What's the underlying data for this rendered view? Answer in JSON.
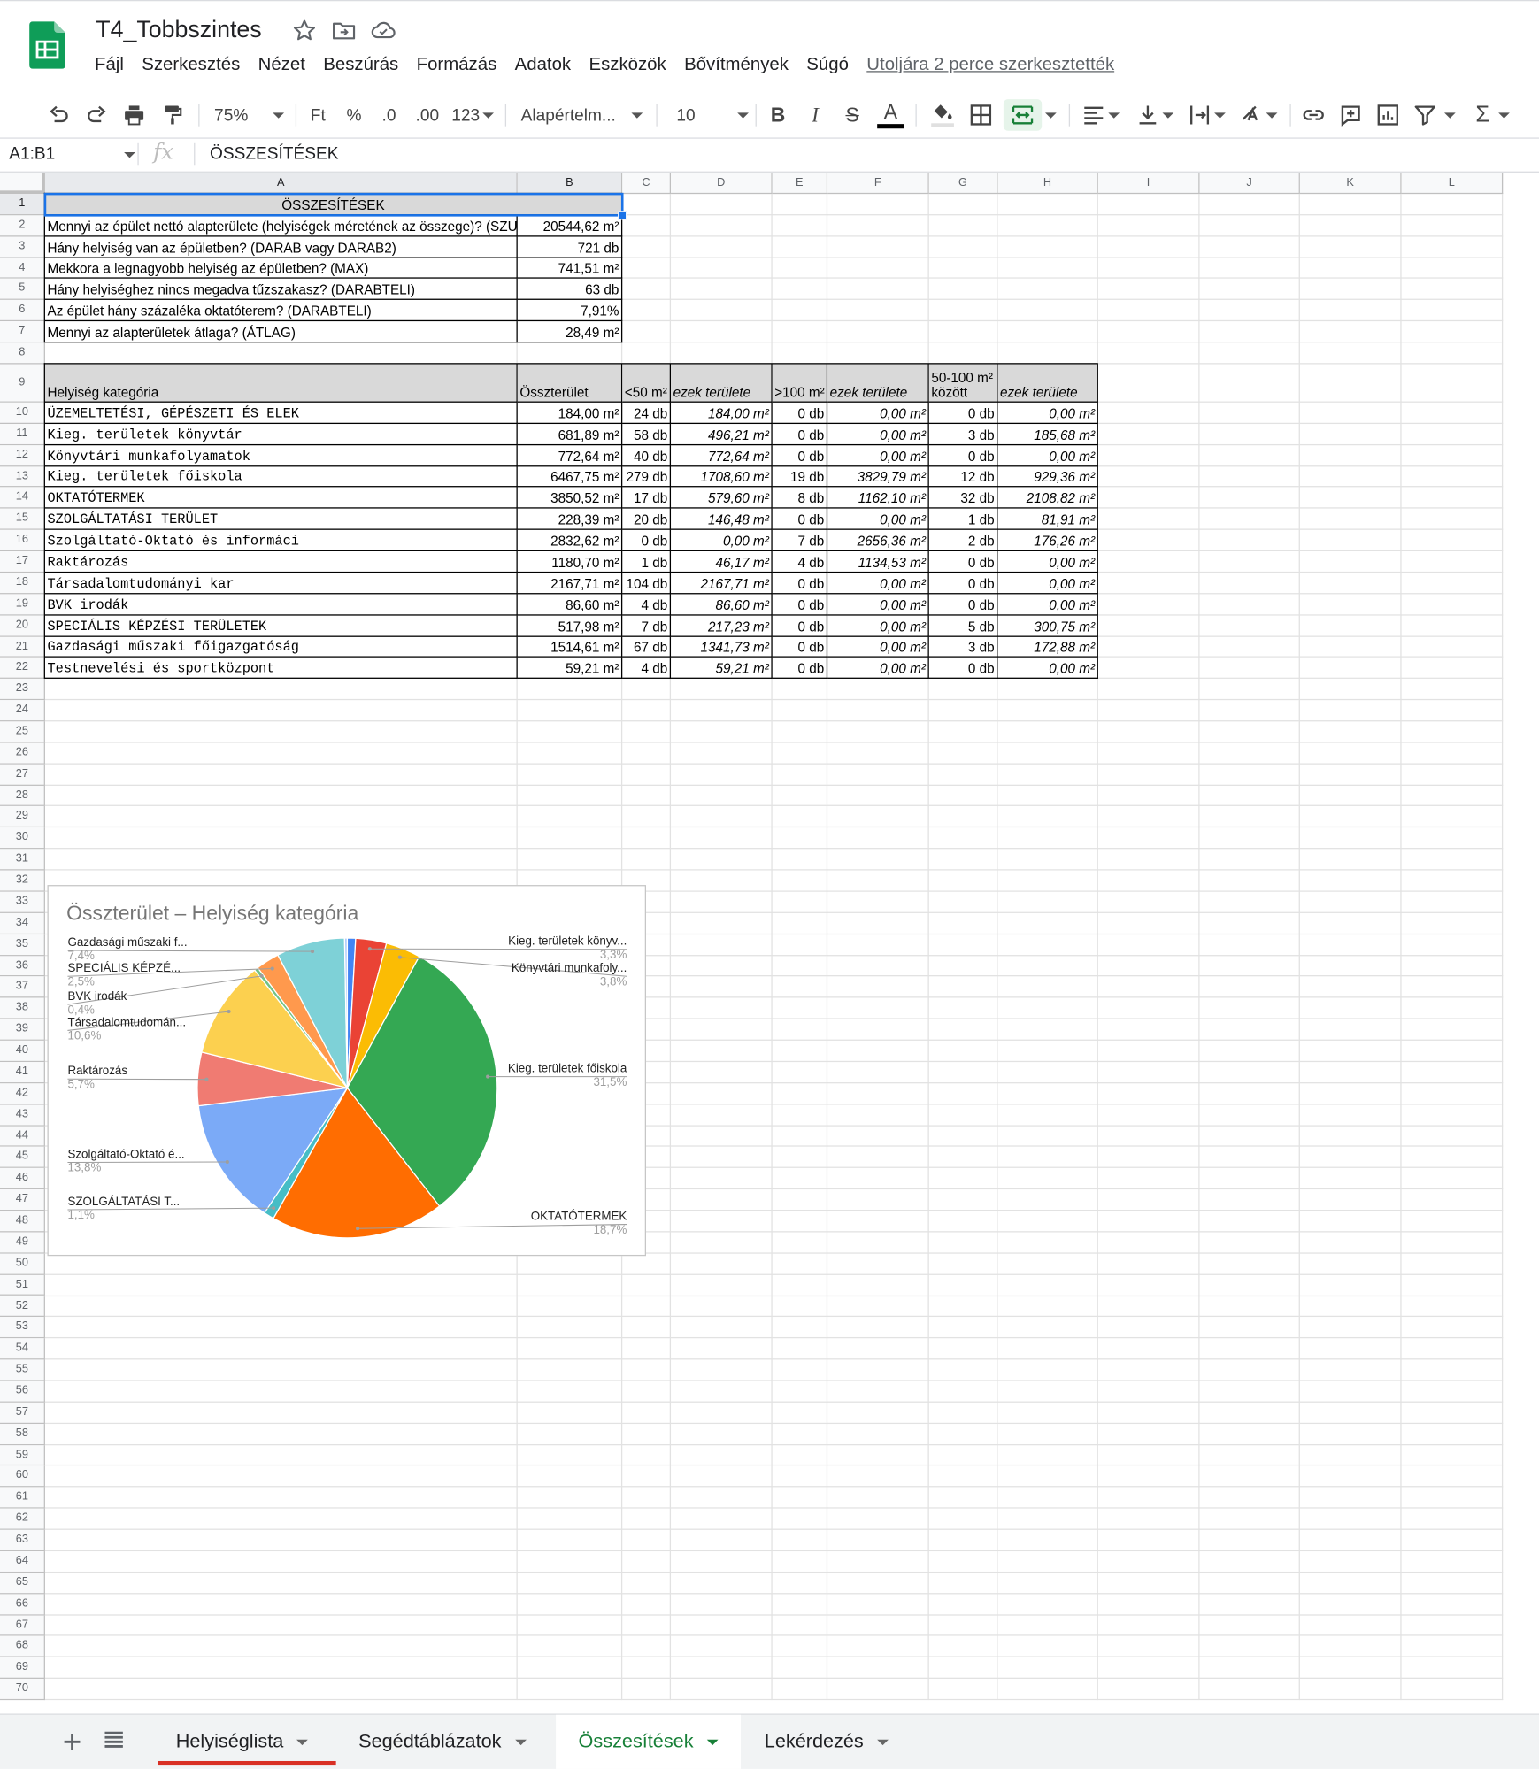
{
  "app": {
    "doc_title": "T4_Tobbszintes",
    "menus": [
      "Fájl",
      "Szerkesztés",
      "Nézet",
      "Beszúrás",
      "Formázás",
      "Adatok",
      "Eszközök",
      "Bővítmények",
      "Súgó"
    ],
    "last_edit": "Utoljára 2 perce szerkesztették"
  },
  "toolbar": {
    "zoom": "75%",
    "currency": "Ft",
    "percent": "%",
    "decimal_decrease": ".0",
    "decimal_increase": ".00",
    "number_format": "123",
    "font": "Alapértelm...",
    "font_size": "10",
    "bold": "B",
    "italic": "I",
    "strike": "S",
    "text_color": "A",
    "sum": "Σ"
  },
  "formula_bar": {
    "name_box": "A1:B1",
    "fx": "fx",
    "content": "ÖSSZESÍTÉSEK"
  },
  "grid": {
    "columns": [
      "A",
      "B",
      "C",
      "D",
      "E",
      "F",
      "G",
      "H",
      "I",
      "J",
      "K",
      "L"
    ],
    "rows": [
      "1",
      "2",
      "3",
      "4",
      "5",
      "6",
      "7",
      "8",
      "9",
      "10",
      "11",
      "12",
      "13",
      "14",
      "15",
      "16",
      "17",
      "18",
      "19",
      "20",
      "21",
      "22",
      "23",
      "24",
      "25",
      "26",
      "27",
      "28",
      "29",
      "30",
      "31",
      "32",
      "33",
      "34",
      "35",
      "36",
      "37",
      "38",
      "39",
      "40",
      "41",
      "42",
      "43",
      "44",
      "45",
      "46",
      "47",
      "48",
      "49",
      "50",
      "51",
      "52",
      "53",
      "54",
      "55",
      "56",
      "57",
      "58",
      "59",
      "60",
      "61",
      "62",
      "63",
      "64",
      "65",
      "66",
      "67",
      "68",
      "69",
      "70"
    ],
    "summary_title": "ÖSSZESÍTÉSEK",
    "summary": [
      {
        "q": "Mennyi az épület nettó alapterülete (helyiségek méretének az összege)? (SZUM)",
        "v": "20544,62 m²"
      },
      {
        "q": "Hány helyiség van az épületben? (DARAB vagy DARAB2)",
        "v": "721 db"
      },
      {
        "q": "Mekkora a legnagyobb helyiség az épületben? (MAX)",
        "v": "741,51 m²"
      },
      {
        "q": "Hány helyiséghez nincs megadva tűzszakasz? (DARABTELI)",
        "v": "63 db"
      },
      {
        "q": "Az épület hány százaléka oktatóterem? (DARABTELI)",
        "v": "7,91%"
      },
      {
        "q": "Mennyi az alapterületek átlaga? (ÁTLAG)",
        "v": "28,49 m²"
      }
    ],
    "table_headers": [
      "Helyiség kategória",
      "Összterület",
      "<50 m²",
      "ezek területe",
      ">100 m²",
      "ezek területe",
      "50-100 m² között",
      "ezek területe"
    ],
    "table_rows": [
      [
        "ÜZEMELTETÉSI, GÉPÉSZETI ÉS ELEK",
        "184,00 m²",
        "24 db",
        "184,00 m²",
        "0 db",
        "0,00 m²",
        "0 db",
        "0,00 m²"
      ],
      [
        "Kieg. területek könyvtár",
        "681,89 m²",
        "58 db",
        "496,21 m²",
        "0 db",
        "0,00 m²",
        "3 db",
        "185,68 m²"
      ],
      [
        "Könyvtári munkafolyamatok",
        "772,64 m²",
        "40 db",
        "772,64 m²",
        "0 db",
        "0,00 m²",
        "0 db",
        "0,00 m²"
      ],
      [
        "Kieg. területek főiskola",
        "6467,75 m²",
        "279 db",
        "1708,60 m²",
        "19 db",
        "3829,79 m²",
        "12 db",
        "929,36 m²"
      ],
      [
        "OKTATÓTERMEK",
        "3850,52 m²",
        "17 db",
        "579,60 m²",
        "8 db",
        "1162,10 m²",
        "32 db",
        "2108,82 m²"
      ],
      [
        "SZOLGÁLTATÁSI TERÜLET",
        "228,39 m²",
        "20 db",
        "146,48 m²",
        "0 db",
        "0,00 m²",
        "1 db",
        "81,91 m²"
      ],
      [
        "Szolgáltató-Oktató és informáci",
        "2832,62 m²",
        "0 db",
        "0,00 m²",
        "7 db",
        "2656,36 m²",
        "2 db",
        "176,26 m²"
      ],
      [
        "Raktározás",
        "1180,70 m²",
        "1 db",
        "46,17 m²",
        "4 db",
        "1134,53 m²",
        "0 db",
        "0,00 m²"
      ],
      [
        "Társadalomtudományi kar",
        "2167,71 m²",
        "104 db",
        "2167,71 m²",
        "0 db",
        "0,00 m²",
        "0 db",
        "0,00 m²"
      ],
      [
        "BVK irodák",
        "86,60 m²",
        "4 db",
        "86,60 m²",
        "0 db",
        "0,00 m²",
        "0 db",
        "0,00 m²"
      ],
      [
        "SPECIÁLIS KÉPZÉSI TERÜLETEK",
        "517,98 m²",
        "7 db",
        "217,23 m²",
        "0 db",
        "0,00 m²",
        "5 db",
        "300,75 m²"
      ],
      [
        "Gazdasági műszaki főigazgatóság",
        "1514,61 m²",
        "67 db",
        "1341,73 m²",
        "0 db",
        "0,00 m²",
        "3 db",
        "172,88 m²"
      ],
      [
        "Testnevelési és sportközpont",
        "59,21 m²",
        "4 db",
        "59,21 m²",
        "0 db",
        "0,00 m²",
        "0 db",
        "0,00 m²"
      ]
    ]
  },
  "chart_data": {
    "type": "pie",
    "title": "Összterület – Helyiség kategória",
    "legend": "labels",
    "slices": [
      {
        "label": "ÜZEMELTETÉSI, GÉPÉSZETI ÉS ELEK",
        "value": 184.0,
        "color": "#4285f4",
        "shown_label": "",
        "shown_pct": ""
      },
      {
        "label": "Kieg. területek könyvtár",
        "value": 681.89,
        "color": "#ea4335",
        "shown_label": "Kieg. területek könyv...",
        "shown_pct": "3,3%"
      },
      {
        "label": "Könyvtári munkafolyamatok",
        "value": 772.64,
        "color": "#fbbc04",
        "shown_label": "Könyvtári munkafoly...",
        "shown_pct": "3,8%"
      },
      {
        "label": "Kieg. területek főiskola",
        "value": 6467.75,
        "color": "#34a853",
        "shown_label": "Kieg. területek főiskola",
        "shown_pct": "31,5%"
      },
      {
        "label": "OKTATÓTERMEK",
        "value": 3850.52,
        "color": "#ff6d01",
        "shown_label": "OKTATÓTERMEK",
        "shown_pct": "18,7%"
      },
      {
        "label": "SZOLGÁLTATÁSI TERÜLET",
        "value": 228.39,
        "color": "#46bdc6",
        "shown_label": "SZOLGÁLTATÁSI T...",
        "shown_pct": "1,1%"
      },
      {
        "label": "Szolgáltató-Oktató és informáci",
        "value": 2832.62,
        "color": "#7baaf7",
        "shown_label": "Szolgáltató-Oktató é...",
        "shown_pct": "13,8%"
      },
      {
        "label": "Raktározás",
        "value": 1180.7,
        "color": "#f07b72",
        "shown_label": "Raktározás",
        "shown_pct": "5,7%"
      },
      {
        "label": "Társadalomtudományi kar",
        "value": 2167.71,
        "color": "#fcd04f",
        "shown_label": "Társadalomtudomán...",
        "shown_pct": "10,6%"
      },
      {
        "label": "BVK irodák",
        "value": 86.6,
        "color": "#71c287",
        "shown_label": "BVK irodák",
        "shown_pct": "0,4%"
      },
      {
        "label": "SPECIÁLIS KÉPZÉSI TERÜLETEK",
        "value": 517.98,
        "color": "#ff994d",
        "shown_label": "SPECIÁLIS KÉPZÉ...",
        "shown_pct": "2,5%"
      },
      {
        "label": "Gazdasági műszaki főigazgatóság",
        "value": 1514.61,
        "color": "#7ed1d7",
        "shown_label": "Gazdasági műszaki f...",
        "shown_pct": "7,4%"
      },
      {
        "label": "Testnevelési és sportközpont",
        "value": 59.21,
        "color": "#b3cefb",
        "shown_label": "",
        "shown_pct": ""
      }
    ]
  },
  "sheets": {
    "tabs": [
      "Helyiséglista",
      "Segédtáblázatok",
      "Összesítések",
      "Lekérdezés"
    ],
    "active": "Összesítések",
    "active_color": "#188038",
    "underline_color": "#d93025"
  }
}
